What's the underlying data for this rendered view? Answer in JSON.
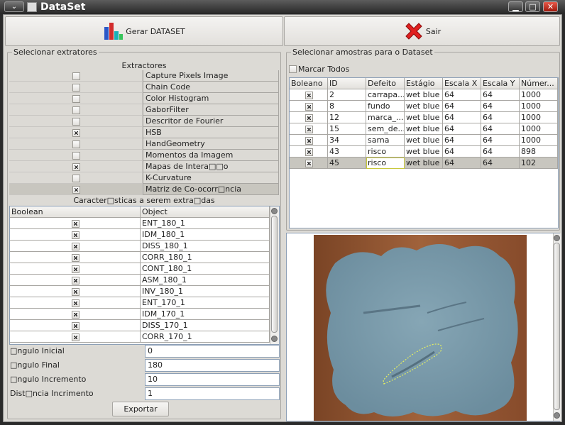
{
  "window": {
    "title": "DataSet",
    "menu_glyph": "⌄",
    "min_glyph": "▁",
    "max_glyph": "□",
    "close_glyph": "✕"
  },
  "toolbar": {
    "gerar_label": "Gerar DATASET",
    "sair_label": "Sair"
  },
  "left": {
    "section_title": "Selecionar extratores",
    "extractors_header": "Extractores",
    "extractors": [
      {
        "checked": false,
        "name": "Capture Pixels Image"
      },
      {
        "checked": false,
        "name": "Chain Code"
      },
      {
        "checked": false,
        "name": "Color Histogram"
      },
      {
        "checked": false,
        "name": "GaborFilter"
      },
      {
        "checked": false,
        "name": "Descritor de Fourier"
      },
      {
        "checked": true,
        "name": "HSB"
      },
      {
        "checked": false,
        "name": "HandGeometry"
      },
      {
        "checked": false,
        "name": "Momentos da Imagem"
      },
      {
        "checked": true,
        "name": "Mapas de Intera□□o"
      },
      {
        "checked": false,
        "name": "K-Curvature"
      },
      {
        "checked": true,
        "name": "Matriz de Co-ocorr□ncia"
      }
    ],
    "features_header": "Caracter□sticas a serem extra□das",
    "features_columns": [
      "Boolean",
      "Object"
    ],
    "features": [
      {
        "checked": true,
        "name": "ENT_180_1"
      },
      {
        "checked": true,
        "name": "IDM_180_1"
      },
      {
        "checked": true,
        "name": "DISS_180_1"
      },
      {
        "checked": true,
        "name": "CORR_180_1"
      },
      {
        "checked": true,
        "name": "CONT_180_1"
      },
      {
        "checked": true,
        "name": "ASM_180_1"
      },
      {
        "checked": true,
        "name": "INV_180_1"
      },
      {
        "checked": true,
        "name": "ENT_170_1"
      },
      {
        "checked": true,
        "name": "IDM_170_1"
      },
      {
        "checked": true,
        "name": "DISS_170_1"
      },
      {
        "checked": true,
        "name": "CORR_170_1"
      }
    ],
    "params": [
      {
        "label": "□ngulo Inicial",
        "value": "0"
      },
      {
        "label": "□ngulo Final",
        "value": "180"
      },
      {
        "label": "□ngulo Incremento",
        "value": "10"
      },
      {
        "label": "Dist□ncia Incrimento",
        "value": "1"
      }
    ],
    "export_label": "Exportar"
  },
  "right": {
    "section_title": "Selecionar amostras para o Dataset",
    "mark_all_label": "Marcar Todos",
    "columns": [
      "Boleano",
      "ID",
      "Defeito",
      "Estágio",
      "Escala X",
      "Escala Y",
      "Númer..."
    ],
    "rows": [
      {
        "checked": true,
        "id": "2",
        "defeito": "carrapa...",
        "estagio": "wet blue",
        "x": "64",
        "y": "64",
        "num": "1000"
      },
      {
        "checked": true,
        "id": "8",
        "defeito": "fundo",
        "estagio": "wet blue",
        "x": "64",
        "y": "64",
        "num": "1000"
      },
      {
        "checked": true,
        "id": "12",
        "defeito": "marca_...",
        "estagio": "wet blue",
        "x": "64",
        "y": "64",
        "num": "1000"
      },
      {
        "checked": true,
        "id": "15",
        "defeito": "sem_de...",
        "estagio": "wet blue",
        "x": "64",
        "y": "64",
        "num": "1000"
      },
      {
        "checked": true,
        "id": "34",
        "defeito": "sarna",
        "estagio": "wet blue",
        "x": "64",
        "y": "64",
        "num": "1000"
      },
      {
        "checked": true,
        "id": "43",
        "defeito": "risco",
        "estagio": "wet blue",
        "x": "64",
        "y": "64",
        "num": "898"
      },
      {
        "checked": true,
        "id": "45",
        "defeito": "risco",
        "estagio": "wet blue",
        "x": "64",
        "y": "64",
        "num": "102"
      }
    ],
    "selected_row": 6
  },
  "colors": {
    "selection": "#c8c6bf",
    "leather": "#7b9bab",
    "background_wood": "#9a5a36"
  }
}
